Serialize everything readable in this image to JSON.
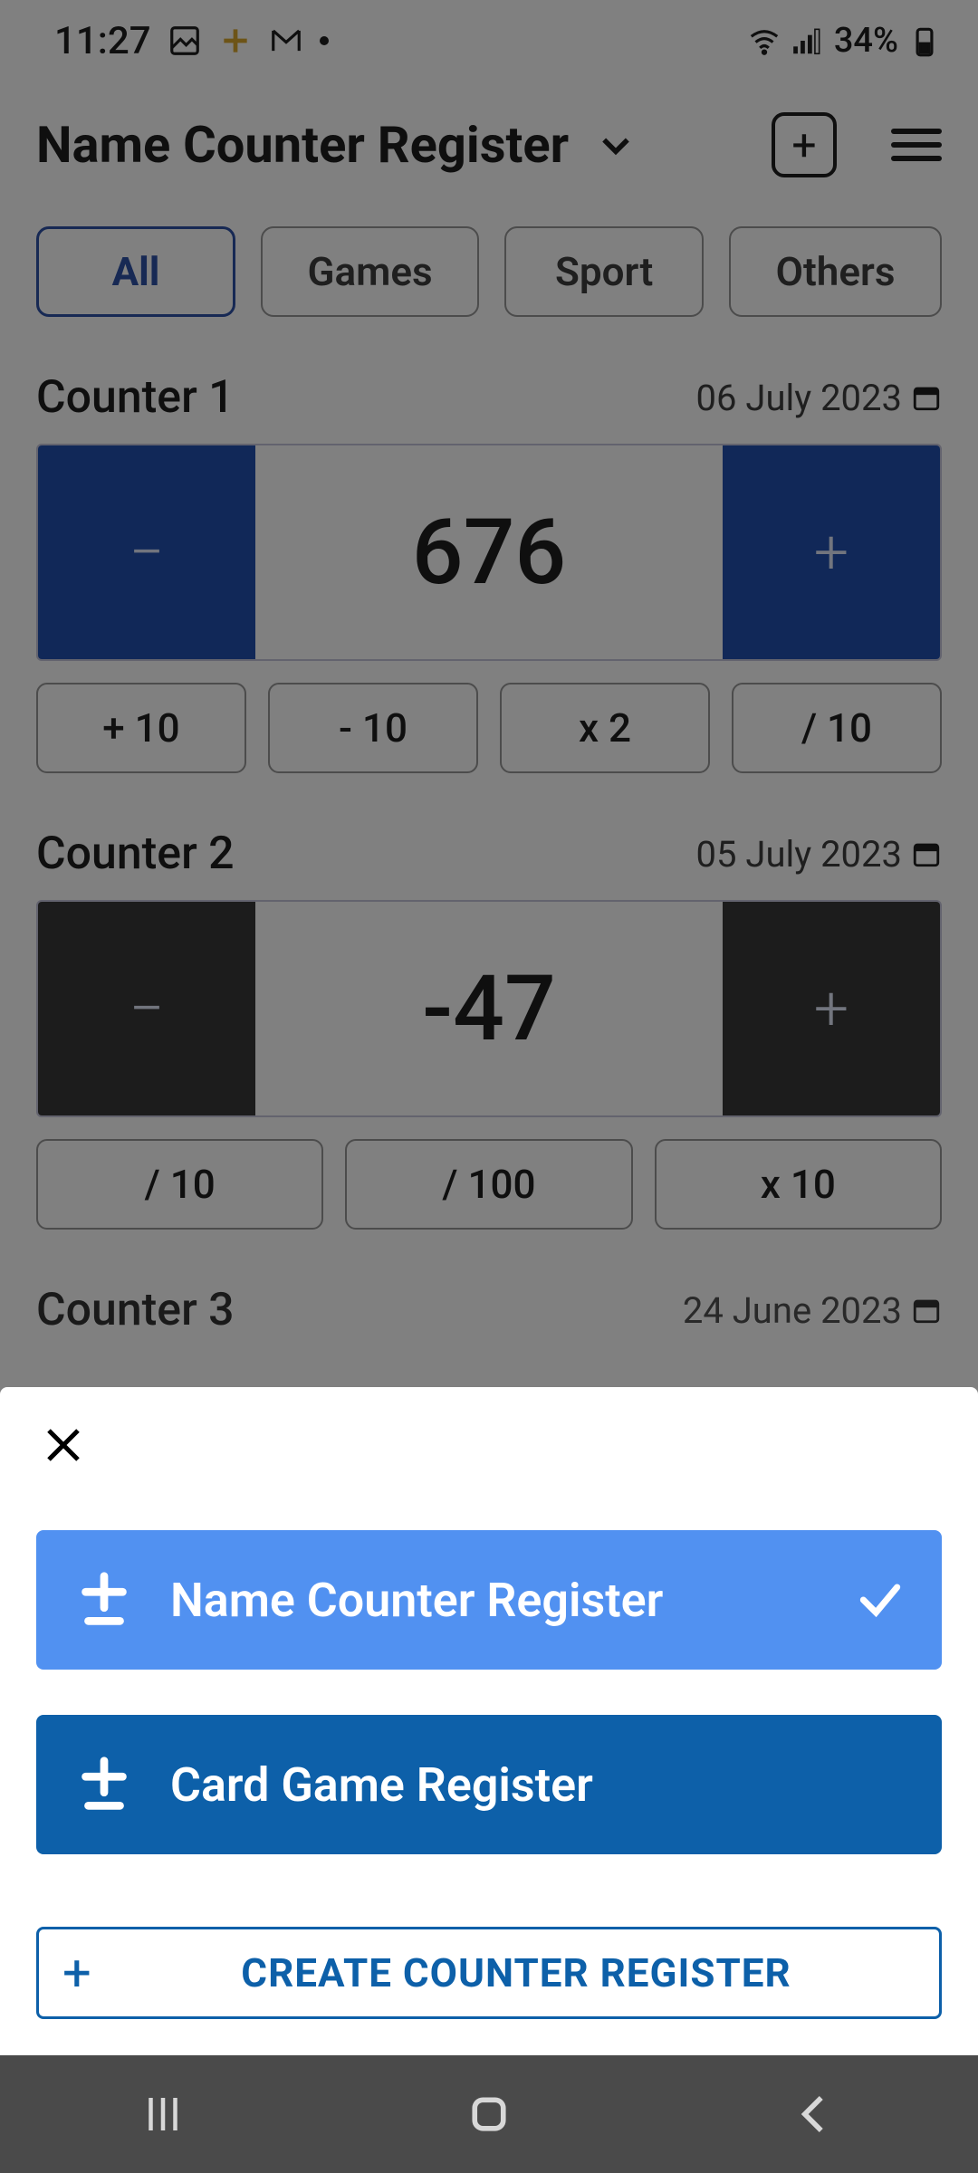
{
  "status": {
    "time": "11:27",
    "battery": "34%"
  },
  "header": {
    "title": "Name Counter Register"
  },
  "tabs": {
    "items": [
      "All",
      "Games",
      "Sport",
      "Others"
    ],
    "activeIndex": 0
  },
  "counters": [
    {
      "name": "Counter 1",
      "date": "06 July 2023",
      "value": "676",
      "theme": "blue",
      "sub": [
        "+ 10",
        "- 10",
        "x 2",
        "/ 10"
      ]
    },
    {
      "name": "Counter 2",
      "date": "05 July 2023",
      "value": "-47",
      "theme": "dark",
      "sub": [
        "/ 10",
        "/ 100",
        "x 10"
      ]
    },
    {
      "name": "Counter 3",
      "date": "24 June 2023"
    }
  ],
  "sheet": {
    "options": [
      {
        "label": "Name Counter Register",
        "selected": true
      },
      {
        "label": "Card Game Register",
        "selected": false
      }
    ],
    "createLabel": "CREATE COUNTER REGISTER"
  }
}
